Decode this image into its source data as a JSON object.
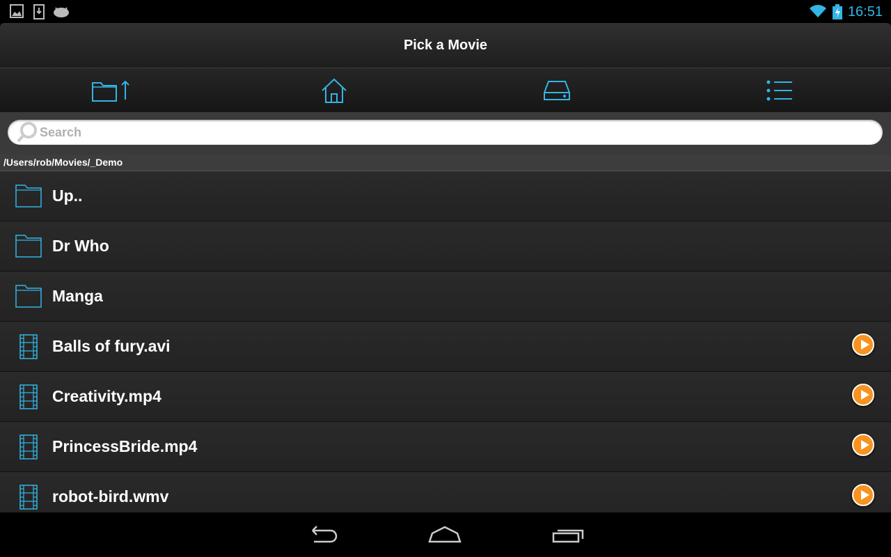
{
  "status": {
    "time": "16:51",
    "icons": [
      "image-notification-icon",
      "download-icon",
      "android-icon",
      "wifi-icon",
      "battery-charging-icon"
    ]
  },
  "title": "Pick a Movie",
  "toolbar": {
    "buttons": [
      "folder-up-icon",
      "home-icon",
      "drive-icon",
      "bookmarks-list-icon"
    ]
  },
  "search": {
    "placeholder": "Search",
    "value": ""
  },
  "path": "/Users/rob/Movies/_Demo",
  "items": [
    {
      "label": "Up..",
      "type": "folder"
    },
    {
      "label": "Dr Who",
      "type": "folder"
    },
    {
      "label": "Manga",
      "type": "folder"
    },
    {
      "label": "Balls of fury.avi",
      "type": "video"
    },
    {
      "label": "Creativity.mp4",
      "type": "video"
    },
    {
      "label": "PrincessBride.mp4",
      "type": "video"
    },
    {
      "label": "robot-bird.wmv",
      "type": "video"
    }
  ],
  "colors": {
    "accent": "#33b5e5",
    "play": "#f7931e"
  }
}
